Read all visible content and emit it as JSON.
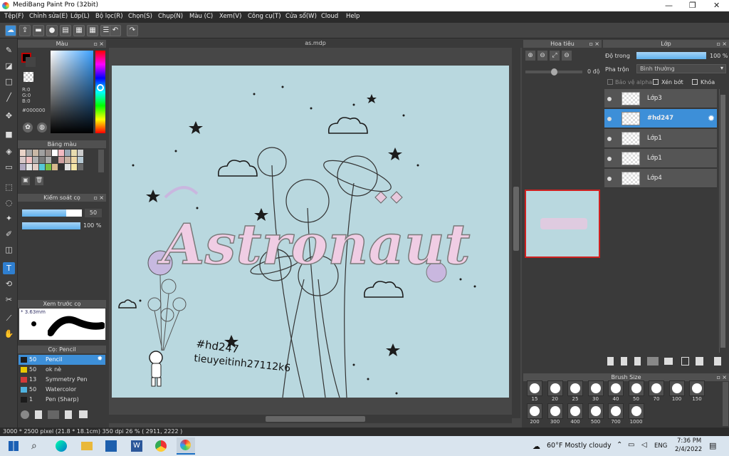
{
  "window": {
    "title": "MediBang Paint Pro (32bit)",
    "controls": [
      "—",
      "❐",
      "✕"
    ]
  },
  "menu": [
    "Tệp(F)",
    "Chỉnh sửa(E)",
    "Lớp(L)",
    "Bộ lọc(R)",
    "Chọn(S)",
    "Chụp(N)",
    "Màu (C)",
    "Xem(V)",
    "Công cụ(T)",
    "Cửa sổ(W)",
    "Cloud",
    "Help"
  ],
  "document": {
    "tab": "as.mdp"
  },
  "color_panel": {
    "title": "Màu",
    "rgb": [
      "R:0",
      "G:0",
      "B:0"
    ],
    "hex": "#000000",
    "fg_color": "#000000",
    "accent": "#c00000"
  },
  "palette_panel": {
    "title": "Bảng màu",
    "swatches": [
      "#e9d3c8",
      "#a9a9a9",
      "#c9b8a6",
      "#a0a0a0",
      "#9a8f8a",
      "#ffffff",
      "#f2b9c1",
      "#9aa8b5",
      "#e8dcb0",
      "#cccccc",
      "#d7c8c8",
      "#f0c0c0",
      "#b0b0b0",
      "#7a7a7a",
      "#aaaaaa",
      "#3f3f3f",
      "#d0a0a0",
      "#c8b2a2",
      "#efd8a6",
      "#b6c9d3",
      "#b0a9c0",
      "#e5e5e5",
      "#e2cfc7",
      "#55c8d8",
      "#7ac043",
      "#d9b98e",
      "#303030",
      "#e0e0e0",
      "#f6e6a6",
      "#6a6a6a"
    ]
  },
  "control_panel": {
    "title": "Kiểm soát cọ",
    "size_value": "50",
    "opacity_value": "100 %"
  },
  "brush_preview": {
    "title": "Xem trước cọ",
    "size_label": "* 3.63mm"
  },
  "brush_list": {
    "title": "Cọ: Pencil",
    "items": [
      {
        "num": "50",
        "label": "Pencil",
        "color": "#1c1c1c",
        "selected": true
      },
      {
        "num": "50",
        "label": "ok nè",
        "color": "#e8c800",
        "selected": false
      },
      {
        "num": "13",
        "label": "Symmetry Pen",
        "color": "#d33a3a",
        "selected": false
      },
      {
        "num": "50",
        "label": "Watercolor",
        "color": "#4fb3e0",
        "selected": false
      },
      {
        "num": "1",
        "label": "Pen (Sharp)",
        "color": "#1c1c1c",
        "selected": false
      }
    ]
  },
  "navigator": {
    "title": "Hoa tiêu",
    "angle": "0 độ"
  },
  "layers": {
    "title": "Lớp",
    "opacity_label": "Độ trong",
    "opacity_value": "100 %",
    "blend_label": "Pha trộn",
    "blend_value": "Bình thường",
    "protect_alpha": "Bảo vệ alpha",
    "clipping": "Xén bớt",
    "lock": "Khóa",
    "items": [
      {
        "name": "Lớp3",
        "selected": false
      },
      {
        "name": "#hd247",
        "selected": true
      },
      {
        "name": "Lớp1",
        "selected": false
      },
      {
        "name": "Lớp1",
        "selected": false
      },
      {
        "name": "Lớp4",
        "selected": false
      }
    ]
  },
  "brush_size": {
    "title": "Brush Size",
    "sizes": [
      "15",
      "20",
      "25",
      "30",
      "40",
      "50",
      "70",
      "100",
      "150",
      "200",
      "300",
      "400",
      "500",
      "700",
      "1000"
    ]
  },
  "artwork": {
    "title_text": "Astronaut",
    "tag1": "#hd247",
    "tag2": "tieuyeitinh27112k6"
  },
  "status": {
    "info": "3000 * 2500 pixel   (21.8 * 18.1cm)   350 dpi   26 %   ( 2911, 2222 )"
  },
  "taskbar": {
    "weather": "60°F  Mostly cloudy",
    "lang": "ENG",
    "time": "7:36 PM",
    "date": "2/4/2022"
  }
}
